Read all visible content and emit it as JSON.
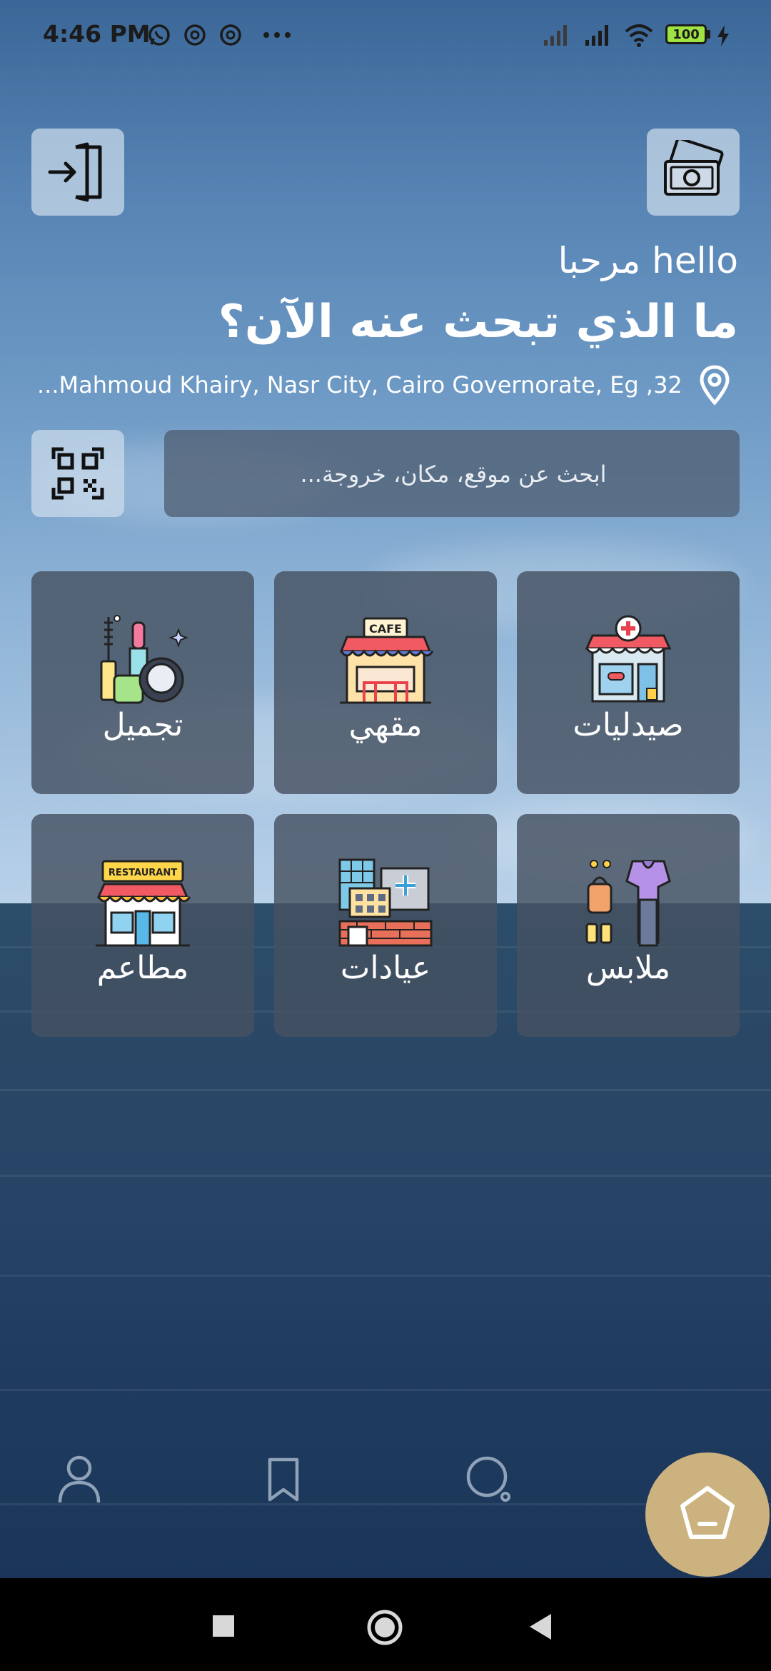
{
  "status_bar": {
    "time": "4:46 PM",
    "battery": "100",
    "icons": [
      "whatsapp-icon",
      "at-icon",
      "at-icon",
      "more-icon",
      "signal-icon",
      "signal-icon",
      "wifi-icon",
      "battery-icon",
      "charging-icon"
    ]
  },
  "header": {
    "greeting": "مرحبا hello",
    "question": "ما الذي تبحث عنه الآن؟",
    "address": "...Mahmoud Khairy, Nasr City, Cairo Governorate, Eg ,32"
  },
  "search": {
    "placeholder": "ابحث عن موقع، مكان، خروجة..."
  },
  "categories": [
    {
      "label": "صيدليات",
      "icon": "pharmacy-icon"
    },
    {
      "label": "مقهي",
      "icon": "cafe-icon",
      "sign": "CAFE"
    },
    {
      "label": "تجميل",
      "icon": "cosmetics-icon"
    },
    {
      "label": "ملابس",
      "icon": "clothes-icon"
    },
    {
      "label": "عيادات",
      "icon": "clinic-icon"
    },
    {
      "label": "مطاعم",
      "icon": "restaurant-icon",
      "sign": "RESTAURANT"
    }
  ],
  "colors": {
    "accent_gold": "#cbb27f",
    "tile": "#4f5f72",
    "battery_fill": "#9ee342"
  }
}
